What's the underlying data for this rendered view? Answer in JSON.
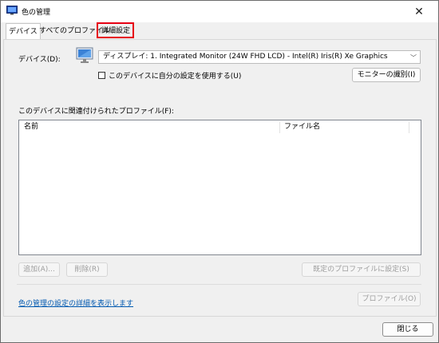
{
  "window": {
    "title": "色の管理",
    "close_glyph": "✕"
  },
  "tabs": [
    {
      "label": "デバイス",
      "active": true
    },
    {
      "label": "すべてのプロファイル",
      "active": false
    },
    {
      "label": "詳細設定",
      "active": false,
      "highlighted": true
    }
  ],
  "device": {
    "label": "デバイス(D):",
    "selected": "ディスプレイ: 1. Integrated Monitor (24W FHD LCD) - Intel(R) Iris(R) Xe Graphics",
    "use_my_settings_label": "このデバイスに自分の設定を使用する(U)",
    "use_my_settings_checked": false,
    "identify_button": "モニターの識別(I)"
  },
  "profiles": {
    "section_label": "このデバイスに関連付けられたプロファイル(F):",
    "columns": [
      "名前",
      "ファイル名"
    ],
    "rows": []
  },
  "actions": {
    "add": "追加(A)...",
    "remove": "削除(R)",
    "set_default": "既定のプロファイルに設定(S)"
  },
  "footer": {
    "details_link": "色の管理の設定の詳細を表示します",
    "profiles_button": "プロファイル(O)",
    "close_button": "閉じる"
  },
  "colors": {
    "highlight": "#e60012",
    "link": "#0058b0"
  }
}
